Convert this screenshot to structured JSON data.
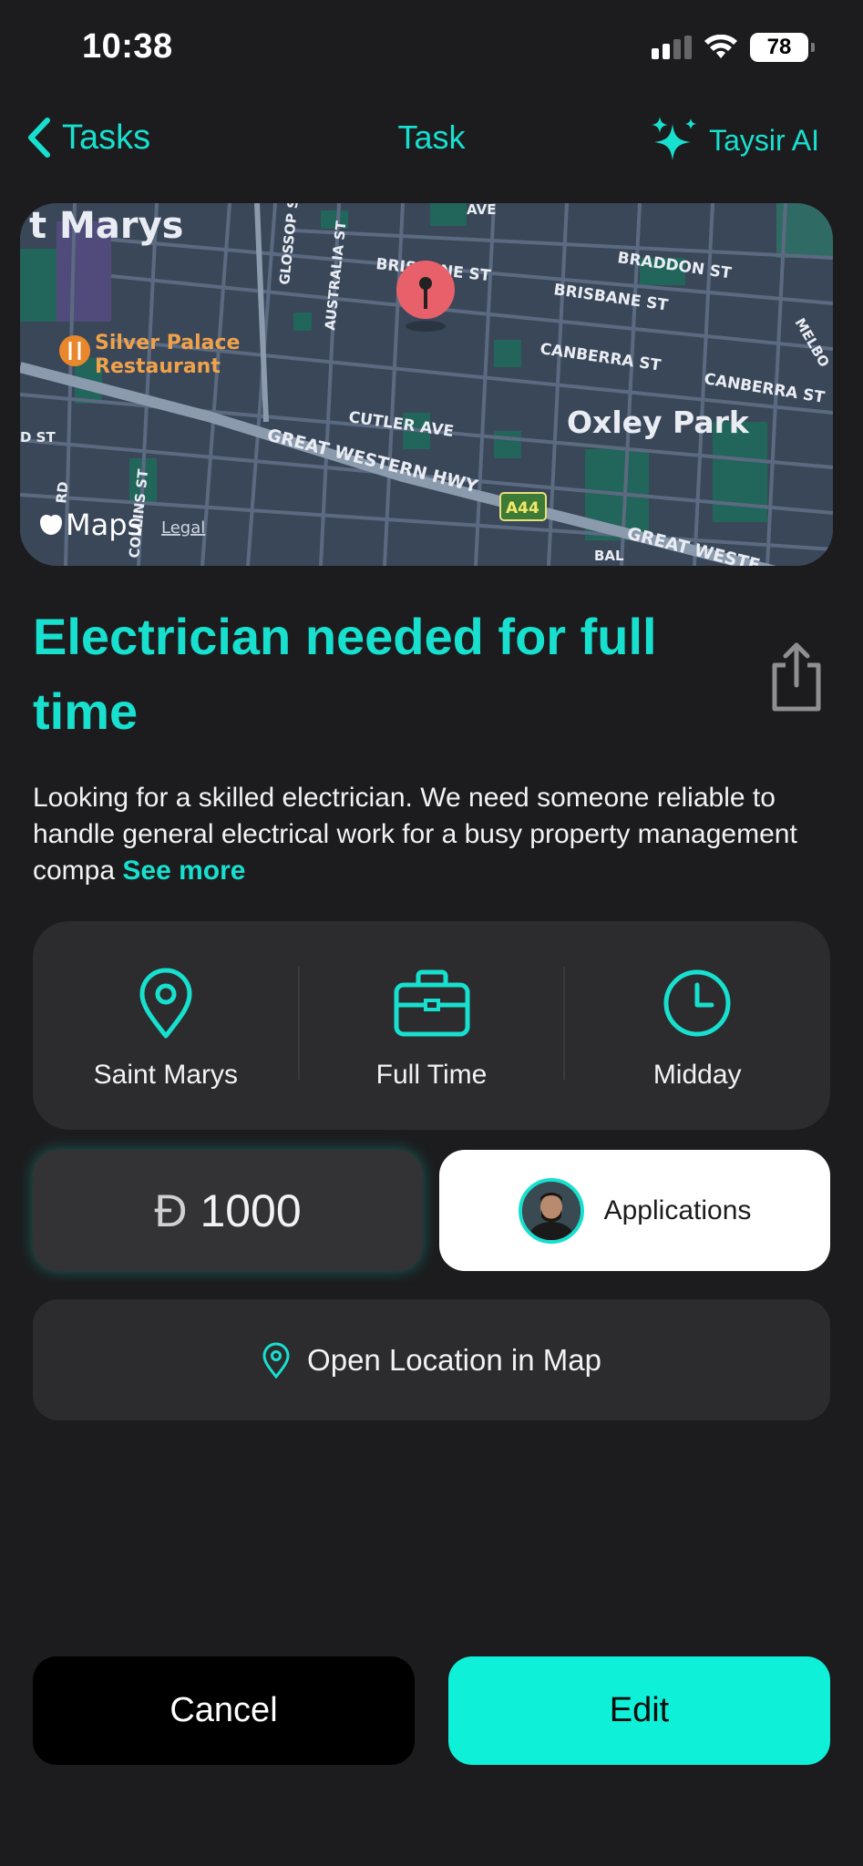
{
  "status_bar": {
    "time": "10:38",
    "battery": "78"
  },
  "nav": {
    "back_label": "Tasks",
    "title": "Task",
    "ai_label": "Taysir AI"
  },
  "map": {
    "labels": {
      "suburb_top": "t Marys",
      "restaurant_line1": "Silver Palace",
      "restaurant_line2": "Restaurant",
      "brisbane1": "BRISBANE ST",
      "brisbane2": "BRISBANE ST",
      "braddon": "BRADDON ST",
      "canberra1": "CANBERRA ST",
      "canberra2": "CANBERRA ST",
      "cutler": "CUTLER AVE",
      "oxley": "Oxley Park",
      "hwy": "GREAT WESTERN HWY",
      "hwy2": "GREAT WESTE",
      "a44": "A44",
      "glossop": "GLOSSOP ST",
      "australia": "AUSTRALIA ST",
      "collins": "COLLINS ST",
      "rd": "RD",
      "dst": "D ST",
      "ave": "AVE",
      "melbo": "MELBO",
      "bal": "BAL",
      "maps_brand": "Maps",
      "legal": "Legal"
    }
  },
  "task": {
    "title": "Electrician needed for full time",
    "description": "Looking for a skilled electrician. We need someone reliable to handle general electrical work for a busy property management compa",
    "see_more": "See more"
  },
  "info": {
    "location": "Saint Marys",
    "job_type": "Full Time",
    "time": "Midday"
  },
  "price": {
    "currency_symbol": "Ð",
    "amount": "1000"
  },
  "applications": {
    "label": "Applications"
  },
  "open_map": {
    "label": "Open Location in Map"
  },
  "actions": {
    "cancel": "Cancel",
    "edit": "Edit"
  },
  "colors": {
    "accent": "#17e0cf",
    "edit_button": "#0ff0d8",
    "background": "#1c1c1e",
    "card": "#2c2c2e"
  }
}
